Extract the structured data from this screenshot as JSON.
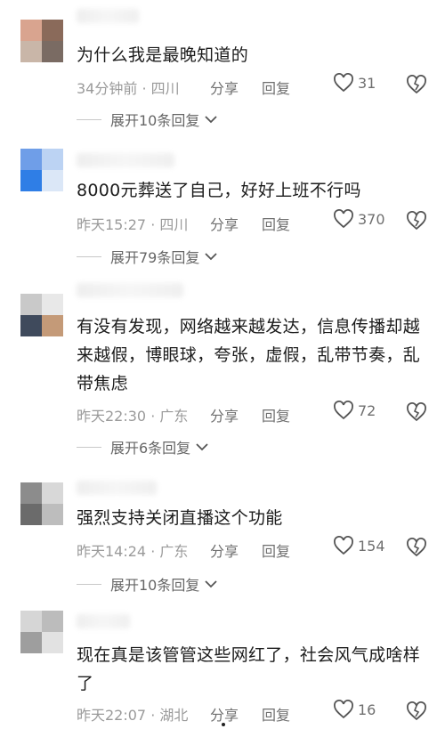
{
  "comments": [
    {
      "text": "为什么我是最晚知道的",
      "meta": "34分钟前 · 四川",
      "share": "分享",
      "reply": "回复",
      "likes": "31",
      "expand": "展开10条回复",
      "avatar_colors": [
        "#d9a48f",
        "#8a6a5a",
        "#c9b6a8",
        "#7a6b63"
      ]
    },
    {
      "text": "8000元葬送了自己，好好上班不行吗",
      "meta": "昨天15:27 · 四川",
      "share": "分享",
      "reply": "回复",
      "likes": "370",
      "expand": "展开79条回复",
      "avatar_colors": [
        "#6f9ee8",
        "#bcd3f3",
        "#2f7ee6",
        "#dbe7f7"
      ]
    },
    {
      "text": "有没有发现，网络越来越发达，信息传播却越来越假，博眼球，夸张，虚假，乱带节奏，乱带焦虑",
      "meta": "昨天22:30 · 广东",
      "share": "分享",
      "reply": "回复",
      "likes": "72",
      "expand": "展开6条回复",
      "avatar_colors": [
        "#c9c9c9",
        "#e8e8e8",
        "#3f4a5c",
        "#c49a78"
      ]
    },
    {
      "text": "强烈支持关闭直播这个功能",
      "meta": "昨天14:24 · 广东",
      "share": "分享",
      "reply": "回复",
      "likes": "154",
      "expand": "展开10条回复",
      "avatar_colors": [
        "#8c8c8c",
        "#d8d8d8",
        "#6b6b6b",
        "#bdbdbd"
      ]
    },
    {
      "text": "现在真是该管管这些网红了，社会风气成啥样了",
      "meta": "昨天22:07 · 湖北",
      "share": "分享",
      "reply": "回复",
      "likes": "16",
      "avatar_colors": [
        "#d6d6d6",
        "#bcbcbc",
        "#9e9e9e",
        "#e2e2e2"
      ]
    }
  ],
  "icons": {
    "like": "heart-outline-icon",
    "dislike": "broken-heart-icon",
    "expand": "chevron-down-icon"
  }
}
